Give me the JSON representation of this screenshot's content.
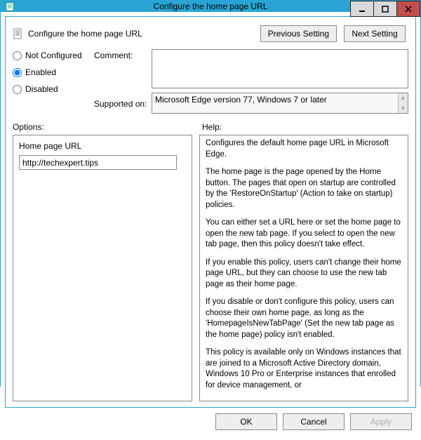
{
  "window": {
    "title": "Configure the home page URL"
  },
  "header": {
    "title": "Configure the home page URL",
    "buttons": {
      "previous": "Previous Setting",
      "next": "Next Setting"
    }
  },
  "state": {
    "radios": {
      "not_configured_label": "Not Configured",
      "enabled_label": "Enabled",
      "disabled_label": "Disabled",
      "selected": "enabled"
    },
    "comment_label": "Comment:",
    "comment_value": "",
    "supported_label": "Supported on:",
    "supported_text": "Microsoft Edge version 77, Windows 7 or later"
  },
  "options": {
    "heading": "Options:",
    "field_label": "Home page URL",
    "field_value": "http://techexpert.tips"
  },
  "help": {
    "heading": "Help:",
    "paragraphs": [
      "Configures the default home page URL in Microsoft Edge.",
      "The home page is the page opened by the Home button. The pages that open on startup are controlled by the 'RestoreOnStartup' (Action to take on startup) policies.",
      "You can either set a URL here or set the home page to open the new tab page. If you select to open the new tab page, then this policy doesn't take effect.",
      "If you enable this policy, users can't change their home page URL, but they can choose to use the new tab page as their home page.",
      "If you disable or don't configure this policy, users can choose their own home page, as long as the 'HomepageIsNewTabPage' (Set the new tab page as the home page) policy isn't enabled.",
      "This policy is available only on Windows instances that are joined to a Microsoft Active Directory domain, Windows 10 Pro or Enterprise instances that enrolled for device management, or"
    ]
  },
  "footer": {
    "ok": "OK",
    "cancel": "Cancel",
    "apply": "Apply"
  }
}
